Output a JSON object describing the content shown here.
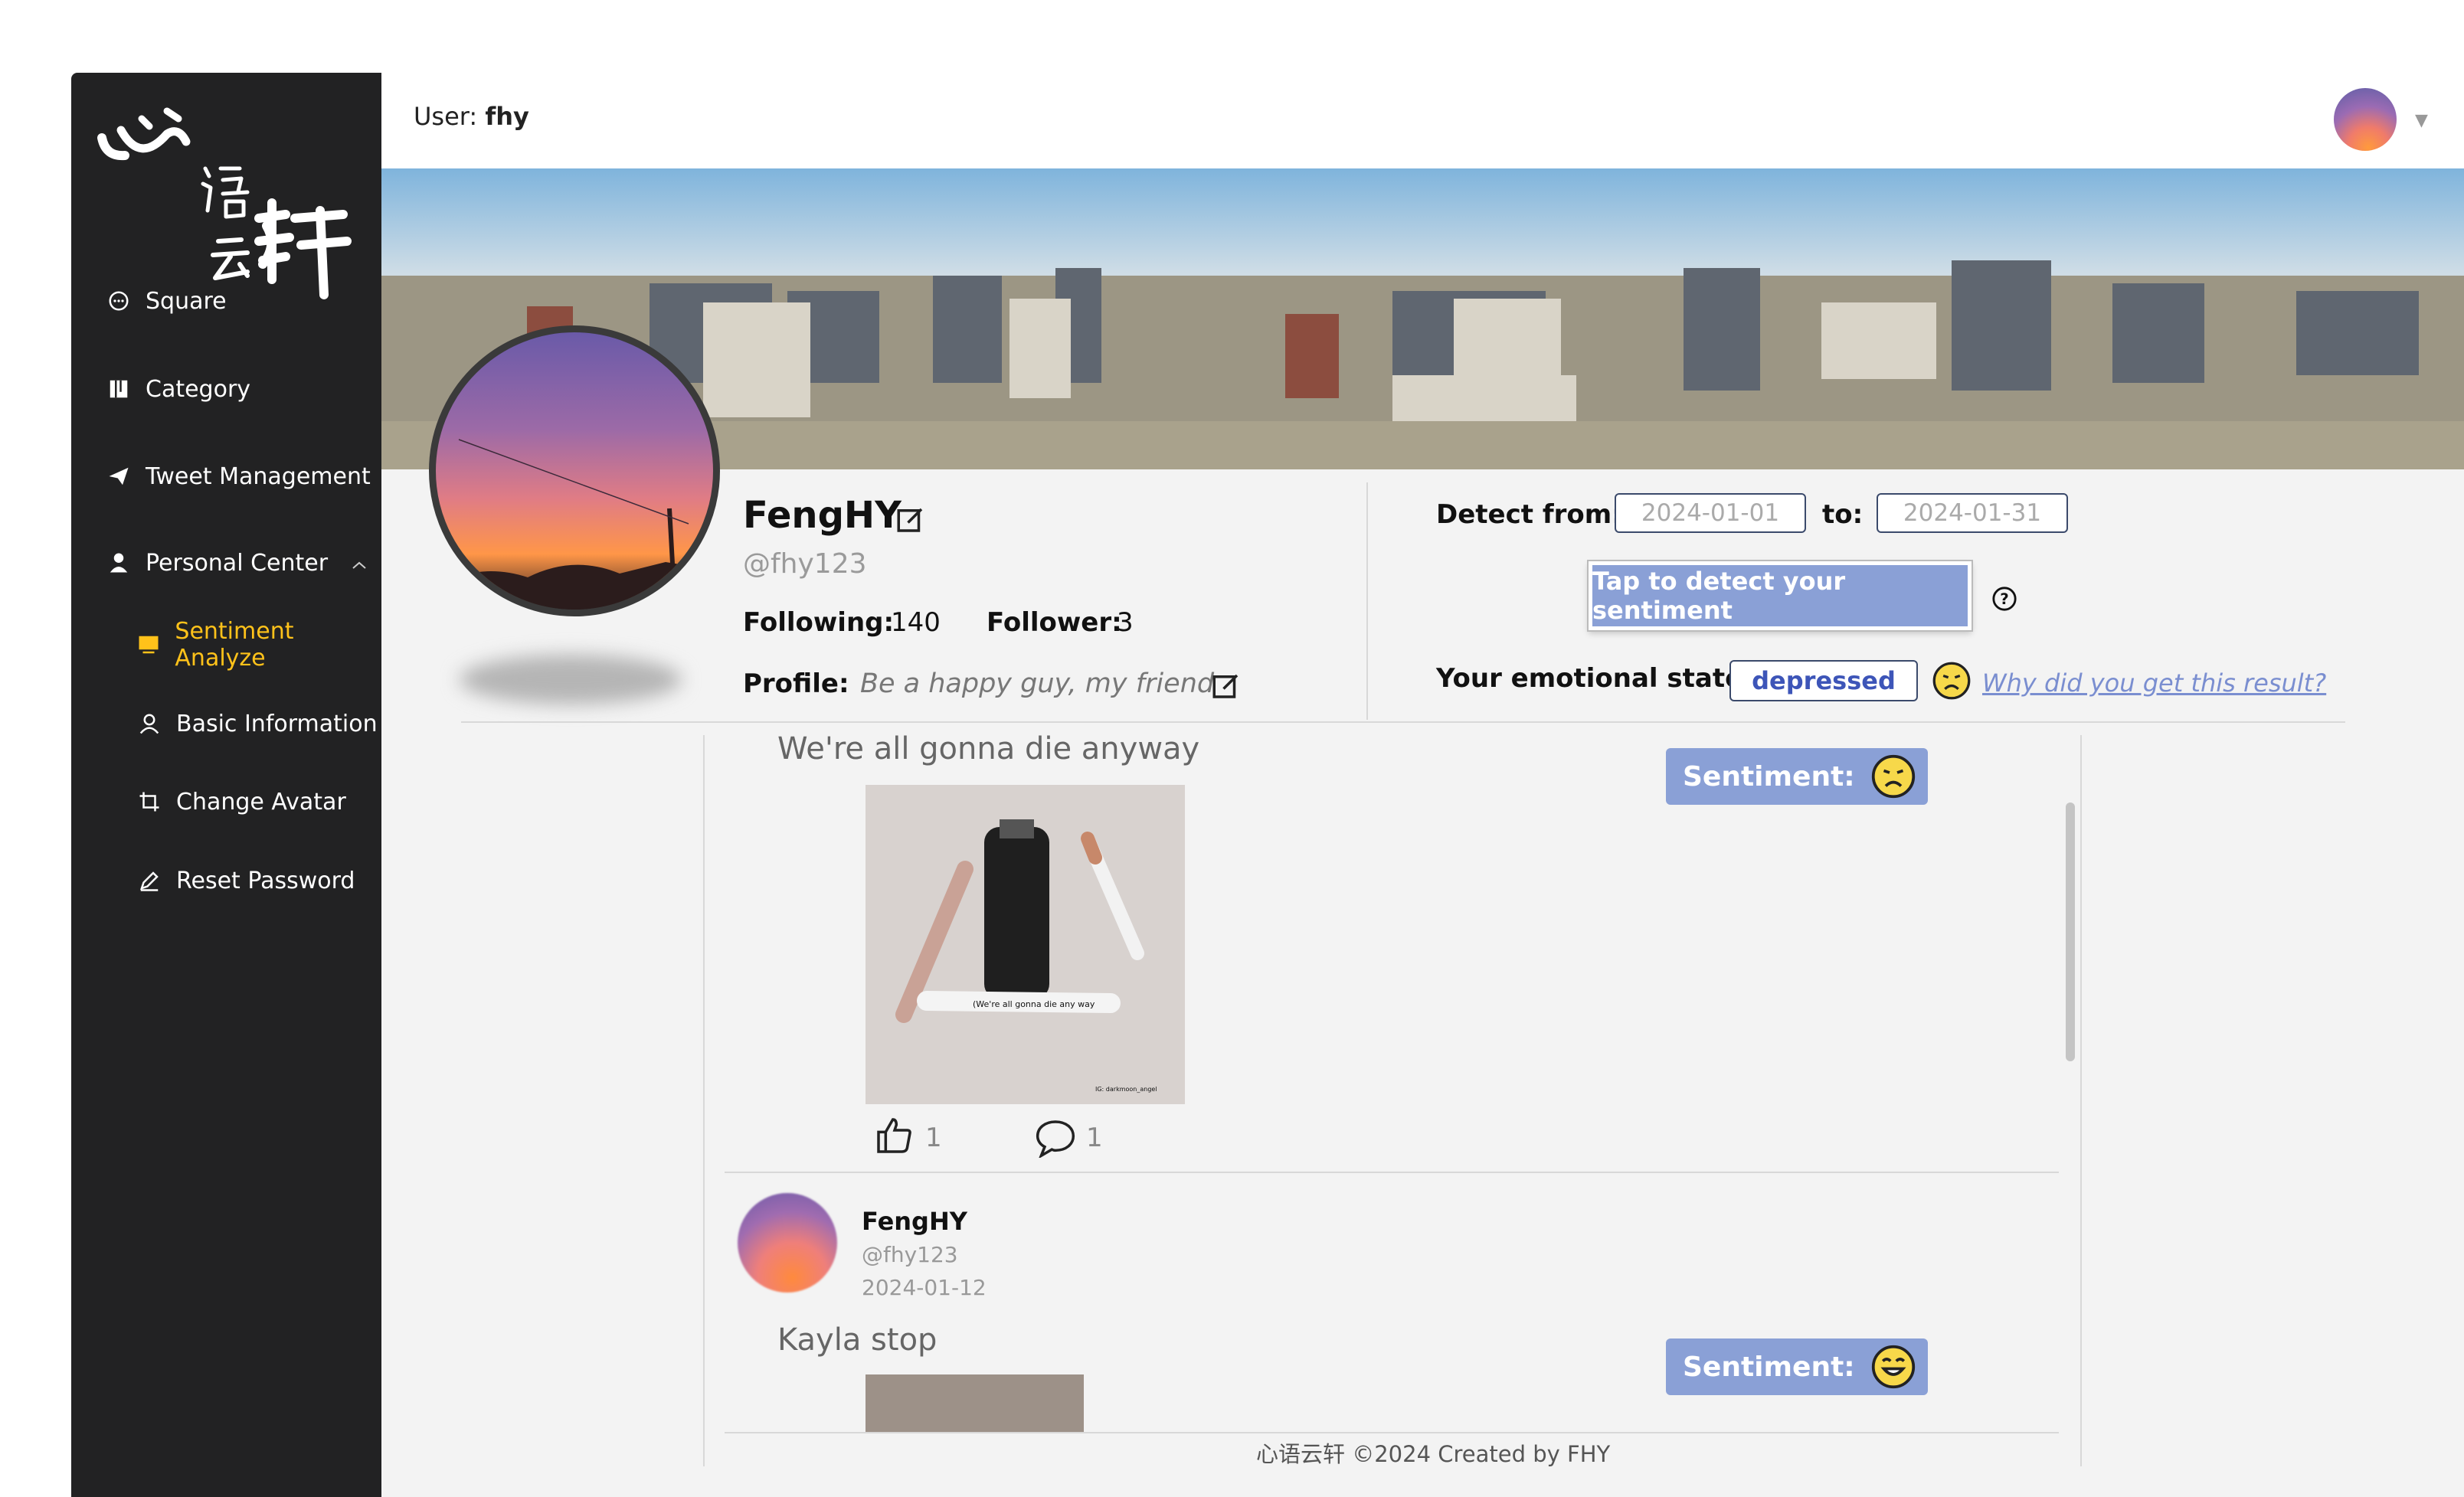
{
  "sidebar": {
    "items": [
      {
        "label": "Square",
        "icon": "chat-bubble-icon"
      },
      {
        "label": "Category",
        "icon": "book-icon"
      },
      {
        "label": "Tweet Management",
        "icon": "send-icon"
      },
      {
        "label": "Personal Center",
        "icon": "user-icon"
      },
      {
        "label": "Sentiment Analyze",
        "icon": "monitor-icon"
      },
      {
        "label": "Basic Information",
        "icon": "user-outline-icon"
      },
      {
        "label": "Change Avatar",
        "icon": "crop-icon"
      },
      {
        "label": "Reset Password",
        "icon": "pen-icon"
      }
    ],
    "active": "Sentiment Analyze",
    "active_color": "#ffc21a"
  },
  "header": {
    "user_prefix": "User:",
    "user_name": "fhy"
  },
  "profile": {
    "name": "FengHY",
    "handle": "@fhy123",
    "following_label": "Following:",
    "following": "140",
    "follower_label": "Follower:",
    "follower": "3",
    "profile_label": "Profile:",
    "profile_text": "Be a happy guy, my friend"
  },
  "detect": {
    "from_label": "Detect from:",
    "from_date": "2024-01-01",
    "to_label": "to:",
    "to_date": "2024-01-31",
    "button_label": "Tap to detect your sentiment",
    "state_label": "Your emotional state:",
    "state_value": "depressed",
    "why_link": "Why did you get this result?"
  },
  "posts": [
    {
      "text": "We're all gonna die anyway",
      "sentiment_label": "Sentiment:",
      "sentiment_icon": "sad-face-icon",
      "image_caption": "(We're all gonna die any way",
      "image_credit": "IG: darkmoon_angel",
      "likes": "1",
      "comments": "1"
    },
    {
      "author": "FengHY",
      "handle": "@fhy123",
      "date": "2024-01-12",
      "text": "Kayla stop",
      "sentiment_label": "Sentiment:",
      "sentiment_icon": "grin-face-icon"
    }
  ],
  "footer": "心语云轩 ©2024 Created by FHY",
  "colors": {
    "sidebar_bg": "#222223",
    "accent_blue": "#8aa0d6",
    "link_blue": "#7a8ed0"
  }
}
